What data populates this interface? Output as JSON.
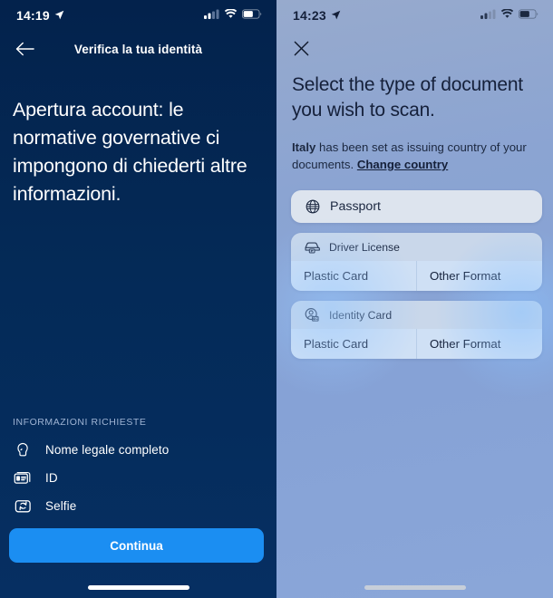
{
  "left": {
    "status": {
      "time": "14:19",
      "location_icon": "location-arrow-icon",
      "signal_icon": "cellular-signal-icon",
      "wifi_icon": "wifi-icon",
      "battery_icon": "battery-icon"
    },
    "nav": {
      "back_icon": "back-arrow-icon",
      "title": "Verifica la tua identità"
    },
    "headline": "Apertura account: le normative governative ci impongono di chiederti altre informazioni.",
    "requirements": {
      "section_label": "INFORMAZIONI RICHIESTE",
      "items": [
        {
          "icon": "head-profile-icon",
          "label": "Nome legale completo"
        },
        {
          "icon": "id-card-icon",
          "label": "ID"
        },
        {
          "icon": "selfie-camera-icon",
          "label": "Selfie"
        }
      ]
    },
    "cta_label": "Continua",
    "colors": {
      "background": "#042a57",
      "accent": "#1b8ef2",
      "section_label": "#9fb4d4"
    }
  },
  "right": {
    "status": {
      "time": "14:23",
      "location_icon": "location-arrow-icon",
      "signal_icon": "cellular-signal-icon",
      "wifi_icon": "wifi-icon",
      "battery_icon": "battery-icon"
    },
    "nav": {
      "close_icon": "close-icon"
    },
    "title": "Select the type of document you wish to scan.",
    "subtitle": {
      "country": "Italy",
      "text_before": "Italy",
      "text_middle": " has been set as issuing country of your documents. ",
      "link": "Change country"
    },
    "documents": [
      {
        "icon": "globe-icon",
        "label": "Passport",
        "options": []
      },
      {
        "icon": "car-icon",
        "label": "Driver License",
        "options": [
          "Plastic Card",
          "Other Format"
        ]
      },
      {
        "icon": "person-badge-icon",
        "label": "Identity Card",
        "options": [
          "Plastic Card",
          "Other Format"
        ]
      }
    ],
    "colors": {
      "background": "#8aa4d4",
      "card_header": "#c9d7ea",
      "card_option": "#cfe0f5",
      "card_single": "#dde4ee",
      "text": "#15203a"
    }
  }
}
